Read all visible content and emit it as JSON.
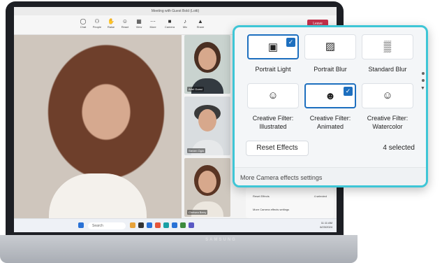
{
  "device": {
    "brand": "SAMSUNG"
  },
  "teams": {
    "title": "Meeting with Guest Bold (Lotti)",
    "toolbar": [
      {
        "label": "Chat",
        "icon": "chat-icon",
        "glyph": "◯"
      },
      {
        "label": "People",
        "icon": "people-icon",
        "glyph": "⚇"
      },
      {
        "label": "Raise",
        "icon": "raise-hand-icon",
        "glyph": "✋"
      },
      {
        "label": "React",
        "icon": "react-icon",
        "glyph": "☺"
      },
      {
        "label": "View",
        "icon": "view-icon",
        "glyph": "▦"
      },
      {
        "label": "More",
        "icon": "more-icon",
        "glyph": "⋯"
      },
      {
        "label": "Camera",
        "icon": "camera-icon",
        "glyph": "■"
      },
      {
        "label": "Mic",
        "icon": "mic-icon",
        "glyph": "♪"
      },
      {
        "label": "Share",
        "icon": "share-icon",
        "glyph": "▲"
      }
    ],
    "leave_label": "Leave",
    "participants": [
      {
        "name": "Adel Guest"
      },
      {
        "name": "Steven Ogin"
      },
      {
        "name": "Chelsea Berry"
      }
    ],
    "mini_panel": {
      "reset": "Reset Effects",
      "count": "4 selected",
      "more": "More Camera effects settings"
    }
  },
  "taskbar": {
    "search_placeholder": "Search",
    "time": "11:11 AM",
    "date": "6/23/2024"
  },
  "effects_panel": {
    "options": [
      {
        "label": "Portrait Light",
        "icon": "portrait-light-icon",
        "glyph": "▣",
        "selected": true
      },
      {
        "label": "Portrait Blur",
        "icon": "portrait-blur-icon",
        "glyph": "▨",
        "selected": false
      },
      {
        "label": "Standard Blur",
        "icon": "standard-blur-icon",
        "glyph": "▒",
        "selected": false
      },
      {
        "label_line1": "Creative Filter:",
        "label_line2": "Illustrated",
        "icon": "creative-illustrated-icon",
        "glyph": "☺",
        "selected": false
      },
      {
        "label_line1": "Creative Filter:",
        "label_line2": "Animated",
        "icon": "creative-animated-icon",
        "glyph": "☻",
        "selected": true
      },
      {
        "label_line1": "Creative Filter:",
        "label_line2": "Watercolor",
        "icon": "creative-watercolor-icon",
        "glyph": "☺",
        "selected": false
      }
    ],
    "reset_label": "Reset Effects",
    "selected_count": "4 selected",
    "footer_link": "More Camera effects settings",
    "check_glyph": "✓",
    "accent": "#1d6fbf",
    "frame": "#3ec6d6"
  }
}
